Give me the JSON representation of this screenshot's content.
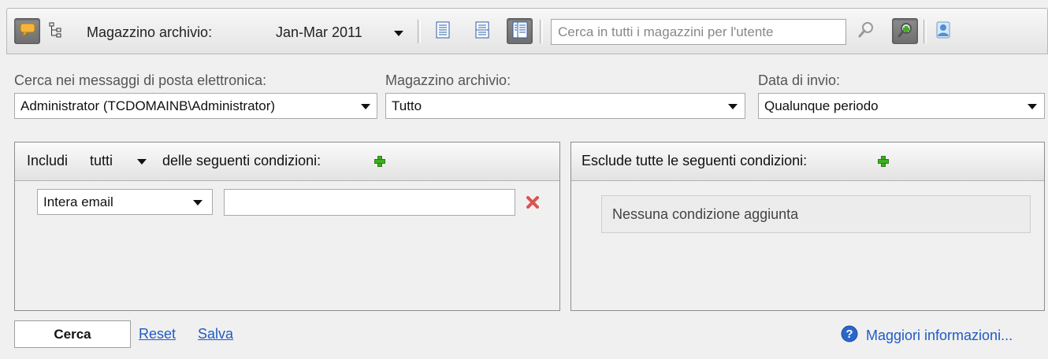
{
  "toolbar": {
    "archive_label": "Magazzino archivio:",
    "archive_period": "Jan-Mar 2011",
    "search_placeholder": "Cerca in tutti i magazzini per l'utente"
  },
  "filters": {
    "mailbox_label": "Cerca nei messaggi di posta elettronica:",
    "mailbox_value": "Administrator (TCDOMAINB\\Administrator)",
    "archive_label": "Magazzino archivio:",
    "archive_value": "Tutto",
    "date_label": "Data di invio:",
    "date_value": "Qualunque periodo"
  },
  "include_panel": {
    "prefix": "Includi",
    "mode": "tutti",
    "suffix": "delle seguenti condizioni:",
    "condition_field": "Intera email",
    "condition_value": ""
  },
  "exclude_panel": {
    "title": "Esclude tutte le seguenti condizioni:",
    "empty_text": "Nessuna condizione aggiunta"
  },
  "actions": {
    "search": "Cerca",
    "reset": "Reset",
    "save": "Salva",
    "more_info": "Maggiori informazioni..."
  },
  "colors": {
    "link": "#1f5bc4",
    "add_icon": "#3fae22",
    "remove_icon": "#d9534f",
    "help_icon": "#2a66c9"
  }
}
